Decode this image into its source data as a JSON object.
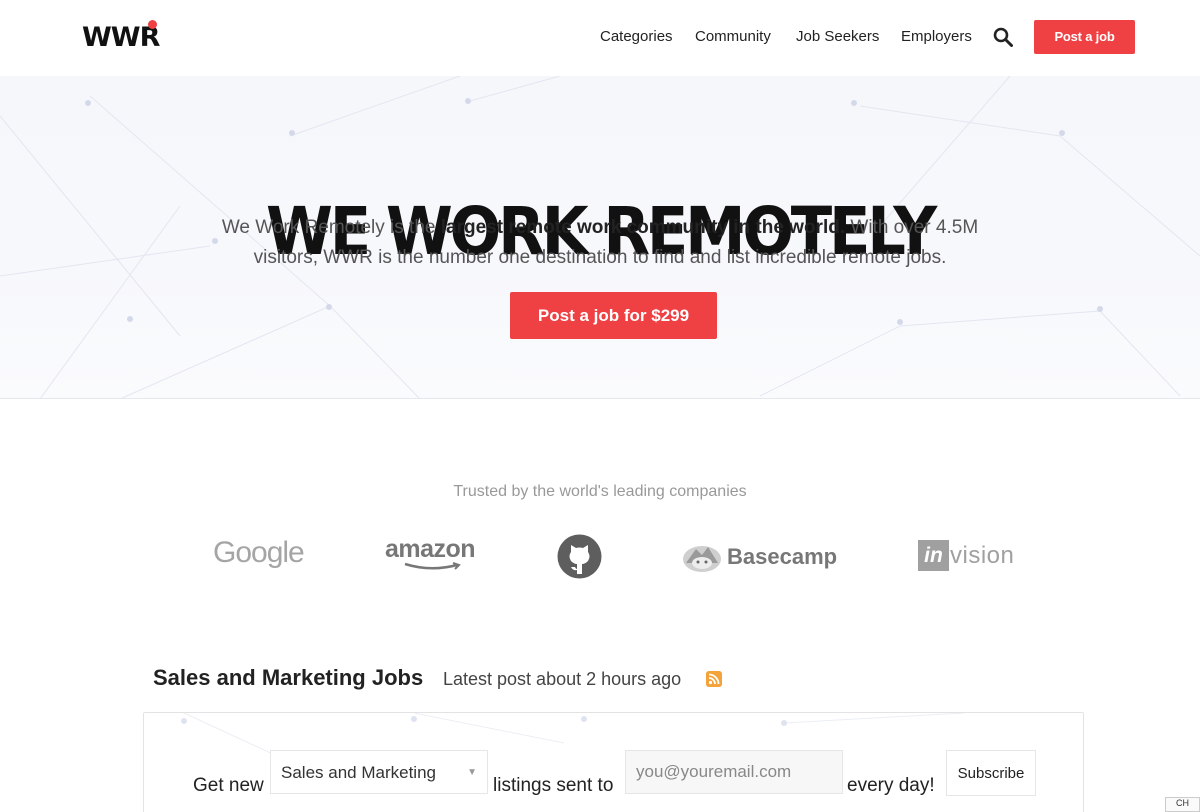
{
  "header": {
    "logo": "WWR",
    "nav": [
      "Categories",
      "Community",
      "Job Seekers",
      "Employers"
    ],
    "post_button": "Post a job"
  },
  "hero": {
    "title": "WE WORK REMOTELY",
    "text_before": "We Work Remotely is the ",
    "text_bold": "largest remote work community in the world.",
    "text_after": " With over 4.5M visitors, WWR is the number one destination to find and list incredible remote jobs.",
    "cta": "Post a job for $299"
  },
  "trusted": {
    "heading": "Trusted by the world's leading companies",
    "logos": [
      "Google",
      "amazon",
      "GitHub",
      "Basecamp",
      "invision"
    ],
    "google": "Google",
    "amazon": "amazon",
    "basecamp": "Basecamp",
    "invision_mark": "in",
    "invision_word": "vision"
  },
  "section": {
    "title": "Sales and Marketing Jobs",
    "meta": "Latest post about 2 hours ago",
    "rss_icon": "rss-icon"
  },
  "signup": {
    "prefix": "Get new",
    "selected_category": "Sales and Marketing",
    "middle": "listings sent to",
    "email_placeholder": "you@youremail.com",
    "suffix": "every day!",
    "button": "Subscribe"
  },
  "corner_tag": "CH",
  "colors": {
    "accent": "#ef4044",
    "hero_bg": "#f6f7fb"
  }
}
